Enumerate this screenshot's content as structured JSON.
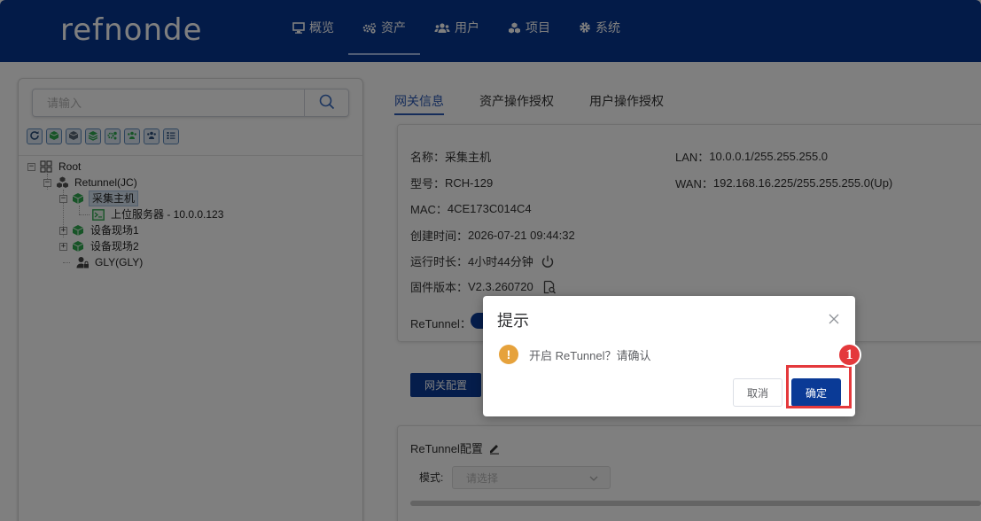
{
  "header": {
    "logo": "refnonde",
    "nav": [
      {
        "label": "概览",
        "icon": "monitor-icon"
      },
      {
        "label": "资产",
        "icon": "gears-icon",
        "active": true
      },
      {
        "label": "用户",
        "icon": "users-icon"
      },
      {
        "label": "项目",
        "icon": "cubes-icon"
      },
      {
        "label": "系统",
        "icon": "gear-icon"
      }
    ]
  },
  "sidebar": {
    "search_placeholder": "请输入",
    "tree": {
      "root": "Root",
      "retunnel": "Retunnel(JC)",
      "gateway": "采集主机",
      "server": "上位服务器 - 10.0.0.123",
      "site1": "设备现场1",
      "site2": "设备现场2",
      "user": "GLY(GLY)"
    }
  },
  "tabs": [
    "网关信息",
    "资产操作授权",
    "用户操作授权"
  ],
  "info": {
    "name_label": "名称：",
    "name": "采集主机",
    "model_label": "型号：",
    "model": "RCH-129",
    "mac_label": "MAC：",
    "mac": "4CE173C014C4",
    "created_label": "创建时间：",
    "created": "2026-07-21 09:44:32",
    "uptime_label": "运行时长：",
    "uptime": "4小时44分钟",
    "firmware_label": "固件版本：",
    "firmware": "V2.3.260720",
    "lan_label": "LAN：",
    "lan": "10.0.0.1/255.255.255.0",
    "wan_label": "WAN：",
    "wan": "192.168.16.225/255.255.255.0(Up)",
    "retunnel_label": "ReTunnel："
  },
  "gateway_config_button": "网关配置",
  "retunnel_config": {
    "title": "ReTunnel配置",
    "mode_label": "模式:",
    "mode_placeholder": "请选择"
  },
  "dialog": {
    "title": "提示",
    "message": "开启 ReTunnel？请确认",
    "cancel": "取消",
    "confirm": "确定"
  },
  "annotation": {
    "step": "1",
    "color": "#e4393c"
  },
  "colors": {
    "primary": "#0a3a96",
    "header": "#073691",
    "warning": "#e6a23c"
  }
}
